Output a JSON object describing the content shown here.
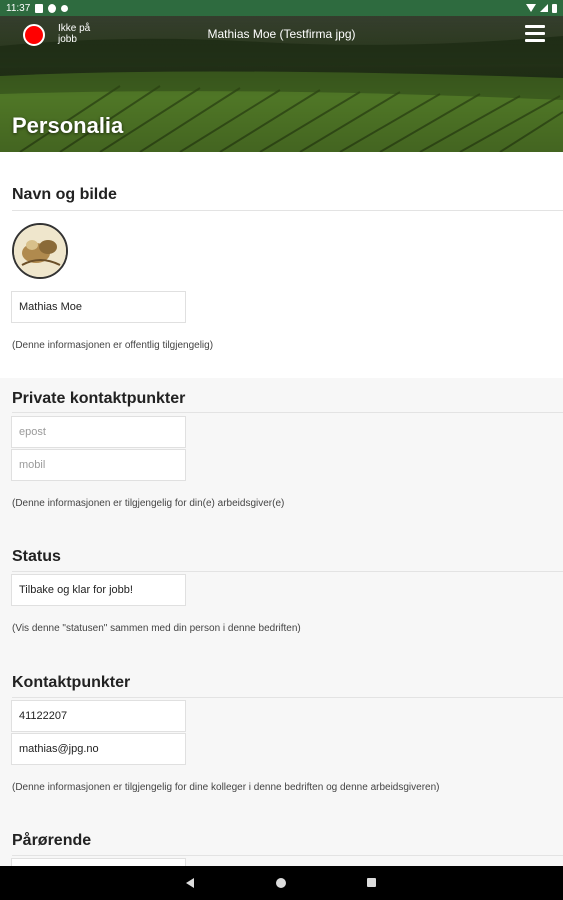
{
  "statusbar": {
    "time": "11:37"
  },
  "header": {
    "status_label": "Ikke på jobb",
    "status_color": "#ff0000",
    "user_title": "Mathias Moe (Testfirma jpg)",
    "page_title": "Personalia"
  },
  "sections": {
    "name": {
      "title": "Navn og bilde",
      "name_value": "Mathias Moe",
      "note": "(Denne informasjonen er offentlig tilgjengelig)"
    },
    "private": {
      "title": "Private kontaktpunkter",
      "email_placeholder": "epost",
      "mobile_placeholder": "mobil",
      "note": "(Denne informasjonen er tilgjengelig for din(e) arbeidsgiver(e)"
    },
    "status": {
      "title": "Status",
      "status_value": "Tilbake og klar for jobb!",
      "note": "(Vis denne \"statusen\" sammen med din person i denne bedriften)"
    },
    "contact": {
      "title": "Kontaktpunkter",
      "phone_value": "41122207",
      "email_value": "mathias@jpg.no",
      "note": "(Denne informasjonen er tilgjengelig for dine kolleger i denne bedriften og denne arbeidsgiveren)"
    },
    "relatives": {
      "title": "Pårørende"
    }
  },
  "icons": [
    "wifi-icon",
    "signal-icon",
    "battery-icon",
    "hamburger-menu-icon",
    "back-icon",
    "home-icon",
    "recent-apps-icon"
  ]
}
